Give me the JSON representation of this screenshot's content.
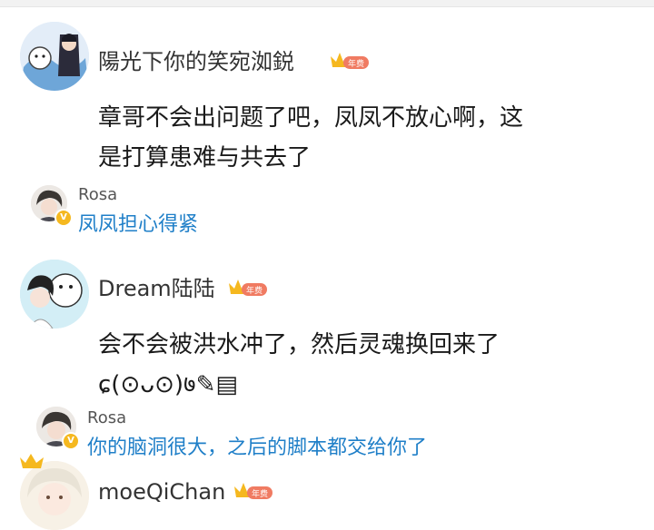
{
  "comments": [
    {
      "username": "陽光下你的笑宛洳鋭",
      "badge_text": "年费",
      "text_line1": "章哥不会出问题了吧，凤凤不放心啊，这",
      "text_line2": "是打算患难与共去了",
      "reply": {
        "name": "Rosa",
        "verified": "V",
        "text": "凤凤担心得紧"
      }
    },
    {
      "username": "Dream陆陆",
      "badge_text": "年费",
      "text_line1": "会不会被洪水冲了，然后灵魂换回来了",
      "text_line2": "ɕ(⊙ᴗ⊙)७✎▤",
      "reply": {
        "name": "Rosa",
        "verified": "V",
        "text": "你的脑洞很大，之后的脚本都交给你了"
      }
    },
    {
      "username": "moeQiChan",
      "badge_text": "年费"
    }
  ],
  "colors": {
    "reply_link": "#1f7fc8",
    "vip_crown": "#f5b81f",
    "vip_badge": "#f07b62"
  }
}
